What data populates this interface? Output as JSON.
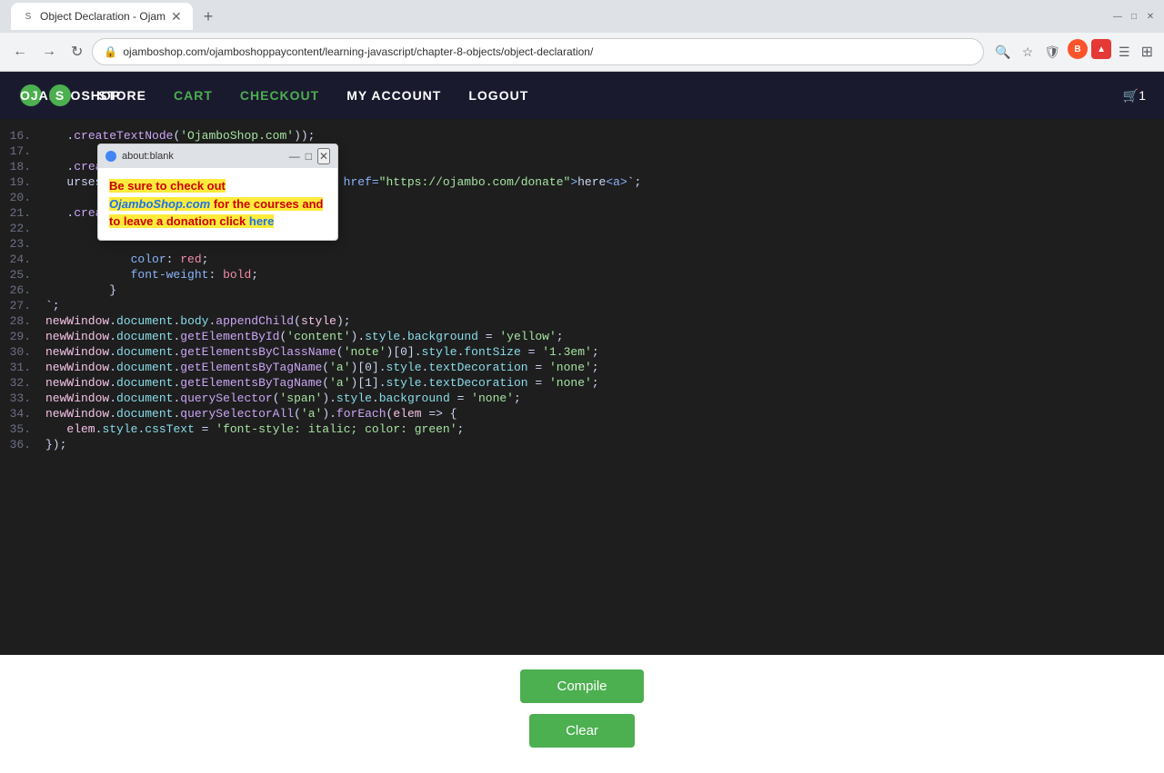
{
  "browser": {
    "tab_title": "Object Declaration - Ojam",
    "tab_favicon": "S",
    "address": "ojamboshop.com/ojamboshoppaycontent/learning-javascript/chapter-8-objects/object-declaration/",
    "new_tab_label": "+",
    "nav_back": "←",
    "nav_forward": "→",
    "nav_refresh": "↻"
  },
  "site_nav": {
    "logo_text": "OJAMBOSHOP",
    "logo_letter": "S",
    "links": [
      "STORE",
      "CART",
      "CHECKOUT",
      "MY ACCOUNT",
      "LOGOUT"
    ],
    "cart_label": "🛒1"
  },
  "tooltip": {
    "sub_title": "about:blank",
    "dot_icon": "●",
    "body_prefix": "Be sure to check out ",
    "link_text": "OjamboShop.com",
    "body_suffix": " for the courses and to leave a donation click ",
    "link_here": "here"
  },
  "code_lines": [
    {
      "num": "16.",
      "content": "   .createTextNode('OjamboShop.com'));"
    },
    {
      "num": "17.",
      "content": ""
    },
    {
      "num": "18.",
      "content": "   .createElement(\"span\");"
    },
    {
      "num": "19.",
      "content": "   urses and to leave a donation click <a href=\"https://ojambo.com/donate\">here<a>`;"
    },
    {
      "num": "20.",
      "content": ""
    },
    {
      "num": "21.",
      "content": "   .createElement(\"style\");"
    },
    {
      "num": "22.",
      "content": ""
    },
    {
      "num": "23.",
      "content": ""
    },
    {
      "num": "24.",
      "content": "            color: red;"
    },
    {
      "num": "25.",
      "content": "            font-weight: bold;"
    },
    {
      "num": "26.",
      "content": "         }"
    },
    {
      "num": "27.",
      "content": "`;"
    },
    {
      "num": "28.",
      "content": "newWindow.document.body.appendChild(style);"
    },
    {
      "num": "29.",
      "content": "newWindow.document.getElementById('content').style.background = 'yellow';"
    },
    {
      "num": "30.",
      "content": "newWindow.document.getElementsByClassName('note')[0].style.fontSize = '1.3em';"
    },
    {
      "num": "31.",
      "content": "newWindow.document.getElementsByTagName('a')[0].style.textDecoration = 'none';"
    },
    {
      "num": "32.",
      "content": "newWindow.document.getElementsByTagName('a')[1].style.textDecoration = 'none';"
    },
    {
      "num": "33.",
      "content": "newWindow.document.querySelector('span').style.background = 'none';"
    },
    {
      "num": "34.",
      "content": "newWindow.document.querySelectorAll('a').forEach(elem => {"
    },
    {
      "num": "35.",
      "content": "   elem.style.cssText = 'font-style: italic; color: green';"
    },
    {
      "num": "36.",
      "content": "});"
    }
  ],
  "buttons": {
    "compile_label": "Compile",
    "clear_label": "Clear"
  }
}
